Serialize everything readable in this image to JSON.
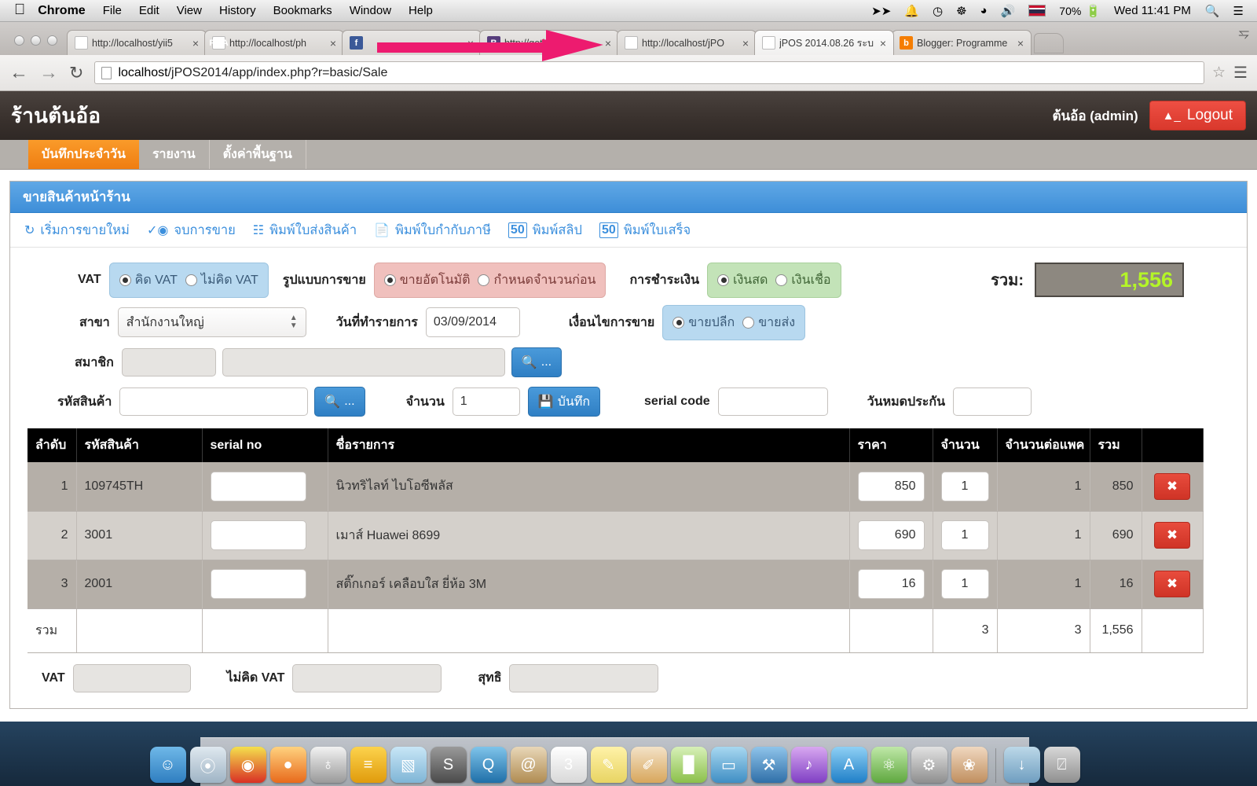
{
  "macbar": {
    "apple_icon": "apple-icon",
    "menus": [
      "Chrome",
      "File",
      "Edit",
      "View",
      "History",
      "Bookmarks",
      "Window",
      "Help"
    ],
    "status_icons": [
      "dropbox-icon",
      "bell-icon",
      "time-machine-icon",
      "bluetooth-icon",
      "wifi-icon",
      "volume-icon"
    ],
    "input_flag": "thai-flag-icon",
    "battery_percent": "70%",
    "clock": "Wed 11:41 PM",
    "search_icon": "spotlight-search-icon",
    "notification_icon": "notification-center-icon"
  },
  "browser": {
    "tabs": [
      {
        "title": "http://localhost/yii5",
        "favicon": "yii-favicon",
        "active": false
      },
      {
        "title": "http://localhost/ph",
        "favicon": "phpmyadmin-favicon",
        "active": false
      },
      {
        "title": "",
        "favicon": "facebook-favicon",
        "active": false
      },
      {
        "title": "http://getbootstrap.",
        "favicon": "bootstrap-favicon",
        "active": false
      },
      {
        "title": "http://localhost/jPO",
        "favicon": "jpos-favicon",
        "active": false
      },
      {
        "title": "jPOS 2014.08.26 ระบ",
        "favicon": "jpos-favicon",
        "active": true
      },
      {
        "title": "Blogger: Programme",
        "favicon": "blogger-favicon",
        "active": false
      }
    ],
    "close_glyph": "×",
    "back_icon": "back-arrow-icon",
    "forward_icon": "forward-arrow-icon",
    "reload_icon": "reload-icon",
    "url_host": "localhost",
    "url_path": "/jPOS2014/app/index.php?r=basic/Sale",
    "star_icon": "bookmark-star-icon",
    "menu_icon": "chrome-menu-icon"
  },
  "app": {
    "brand": "ร้านต้นอ้อ",
    "user": "ต้นอ้อ (admin)",
    "logout_label": "Logout",
    "nav_tabs": [
      {
        "label": "บันทึกประจำวัน",
        "active": true
      },
      {
        "label": "รายงาน",
        "active": false
      },
      {
        "label": "ตั้งค่าพื้นฐาน",
        "active": false
      }
    ]
  },
  "panel": {
    "title": "ขายสินค้าหน้าร้าน",
    "toolbar": [
      {
        "label": "เริ่มการขายใหม่",
        "icon": "refresh-icon"
      },
      {
        "label": "จบการขาย",
        "icon": "check-circle-icon"
      },
      {
        "label": "พิมพ์ใบส่งสินค้า",
        "icon": "document-list-icon"
      },
      {
        "label": "พิมพ์ใบกำกับภาษี",
        "icon": "file-icon"
      },
      {
        "label": "พิมพ์สลิป",
        "icon": "slip-50-icon"
      },
      {
        "label": "พิมพ์ใบเสร็จ",
        "icon": "receipt-50-icon"
      }
    ]
  },
  "form": {
    "vat_label": "VAT",
    "vat_options": [
      {
        "label": "คิด VAT",
        "selected": true
      },
      {
        "label": "ไม่คิด VAT",
        "selected": false
      }
    ],
    "sale_mode_label": "รูปแบบการขาย",
    "sale_mode_options": [
      {
        "label": "ขายอัตโนมัติ",
        "selected": true
      },
      {
        "label": "กำหนดจำนวนก่อน",
        "selected": false
      }
    ],
    "payment_label": "การชำระเงิน",
    "payment_options": [
      {
        "label": "เงินสด",
        "selected": true
      },
      {
        "label": "เงินเชื่อ",
        "selected": false
      }
    ],
    "total_label": "รวม:",
    "total_value": "1,556",
    "branch_label": "สาขา",
    "branch_value": "สำนักงานใหญ่",
    "date_label": "วันที่ทำรายการ",
    "date_value": "03/09/2014",
    "sale_cond_label": "เงื่อนไขการขาย",
    "sale_cond_options": [
      {
        "label": "ขายปลีก",
        "selected": true
      },
      {
        "label": "ขายส่ง",
        "selected": false
      }
    ],
    "member_label": "สมาชิก",
    "member_code_value": "",
    "member_name_value": "",
    "member_search_label": "...",
    "product_code_label": "รหัสสินค้า",
    "product_code_value": "",
    "product_search_label": "...",
    "qty_label": "จำนวน",
    "qty_value": "1",
    "save_label": "บันทึก",
    "serial_code_label": "serial code",
    "serial_code_value": "",
    "warranty_label": "วันหมดประกัน",
    "warranty_value": ""
  },
  "table": {
    "columns": [
      "ลำดับ",
      "รหัสสินค้า",
      "serial no",
      "ชื่อรายการ",
      "ราคา",
      "จำนวน",
      "จำนวนต่อแพค",
      "รวม",
      ""
    ],
    "rows": [
      {
        "no": "1",
        "code": "109745TH",
        "serial": "",
        "name": "นิวทริไลท์ ไบโอซีพลัส",
        "price": "850",
        "qty": "1",
        "per_pack": "1",
        "total": "850",
        "delete_glyph": "✖"
      },
      {
        "no": "2",
        "code": "3001",
        "serial": "",
        "name": "เมาส์ Huawei 8699",
        "price": "690",
        "qty": "1",
        "per_pack": "1",
        "total": "690",
        "delete_glyph": "✖"
      },
      {
        "no": "3",
        "code": "2001",
        "serial": "",
        "name": "สติ๊กเกอร์ เคลือบใส ยี่ห้อ 3M",
        "price": "16",
        "qty": "1",
        "per_pack": "1",
        "total": "16",
        "delete_glyph": "✖"
      }
    ],
    "summary": {
      "label": "รวม",
      "qty": "3",
      "per_pack": "3",
      "total": "1,556"
    }
  },
  "bottom": {
    "vat_label": "VAT",
    "vat_value": "",
    "novat_label": "ไม่คิด VAT",
    "novat_value": "",
    "net_label": "สุทธิ",
    "net_value": ""
  },
  "dock": {
    "items": [
      {
        "name": "finder-icon",
        "color1": "#6fb8e8",
        "color2": "#2f7ec0",
        "glyph": "☺"
      },
      {
        "name": "safari-icon",
        "color1": "#dfe8ef",
        "color2": "#9fb4c5",
        "glyph": "⦿"
      },
      {
        "name": "chrome-icon",
        "color1": "#f4e04d",
        "color2": "#d93025",
        "glyph": "◉"
      },
      {
        "name": "firefox-icon",
        "color1": "#ffd27f",
        "color2": "#e86a1b",
        "glyph": "●"
      },
      {
        "name": "sequel-pro-icon",
        "color1": "#f2f2f2",
        "color2": "#9a9a9a",
        "glyph": "♁"
      },
      {
        "name": "xampp-icon",
        "color1": "#fcd34d",
        "color2": "#e09b0c",
        "glyph": "≡"
      },
      {
        "name": "virtualbox-icon",
        "color1": "#c8e6f6",
        "color2": "#7fb5d6",
        "glyph": "▧"
      },
      {
        "name": "sublime-text-icon",
        "color1": "#9a9a9a",
        "color2": "#4a4a4a",
        "glyph": "S"
      },
      {
        "name": "quicktime-icon",
        "color1": "#7fc4ea",
        "color2": "#1f6fa8",
        "glyph": "Q"
      },
      {
        "name": "mail-icon",
        "color1": "#e8d7b8",
        "color2": "#b08c52",
        "glyph": "@"
      },
      {
        "name": "calendar-icon",
        "color1": "#ffffff",
        "color2": "#d8d8d8",
        "glyph": "3"
      },
      {
        "name": "notes-icon",
        "color1": "#fff2a8",
        "color2": "#e8d463",
        "glyph": "✎"
      },
      {
        "name": "pages-icon",
        "color1": "#f3e2c7",
        "color2": "#d8a75c",
        "glyph": "✐"
      },
      {
        "name": "numbers-icon",
        "color1": "#d7f0b8",
        "color2": "#8cc04b",
        "glyph": "█"
      },
      {
        "name": "keynote-icon",
        "color1": "#a8d8f0",
        "color2": "#3f8ec4",
        "glyph": "▭"
      },
      {
        "name": "xcode-icon",
        "color1": "#8fc4ea",
        "color2": "#2f6fa8",
        "glyph": "⚒"
      },
      {
        "name": "itunes-icon",
        "color1": "#d8a8f0",
        "color2": "#7f3fc4",
        "glyph": "♪"
      },
      {
        "name": "app-store-icon",
        "color1": "#8fd0f4",
        "color2": "#1f7fc8",
        "glyph": "A"
      },
      {
        "name": "reeder-icon",
        "color1": "#bfe8a8",
        "color2": "#5fa83f",
        "glyph": "⚛"
      },
      {
        "name": "system-preferences-icon",
        "color1": "#e2e2e2",
        "color2": "#8f8f8f",
        "glyph": "⚙"
      },
      {
        "name": "iphoto-icon",
        "color1": "#f0d8c0",
        "color2": "#c08f5f",
        "glyph": "❀"
      },
      {
        "name": "downloads-stack-icon",
        "color1": "#bcd8e8",
        "color2": "#6f9ec0",
        "glyph": "↓"
      },
      {
        "name": "trash-icon",
        "color1": "#d8d8d8",
        "color2": "#8f8f8f",
        "glyph": "⍁"
      }
    ]
  }
}
